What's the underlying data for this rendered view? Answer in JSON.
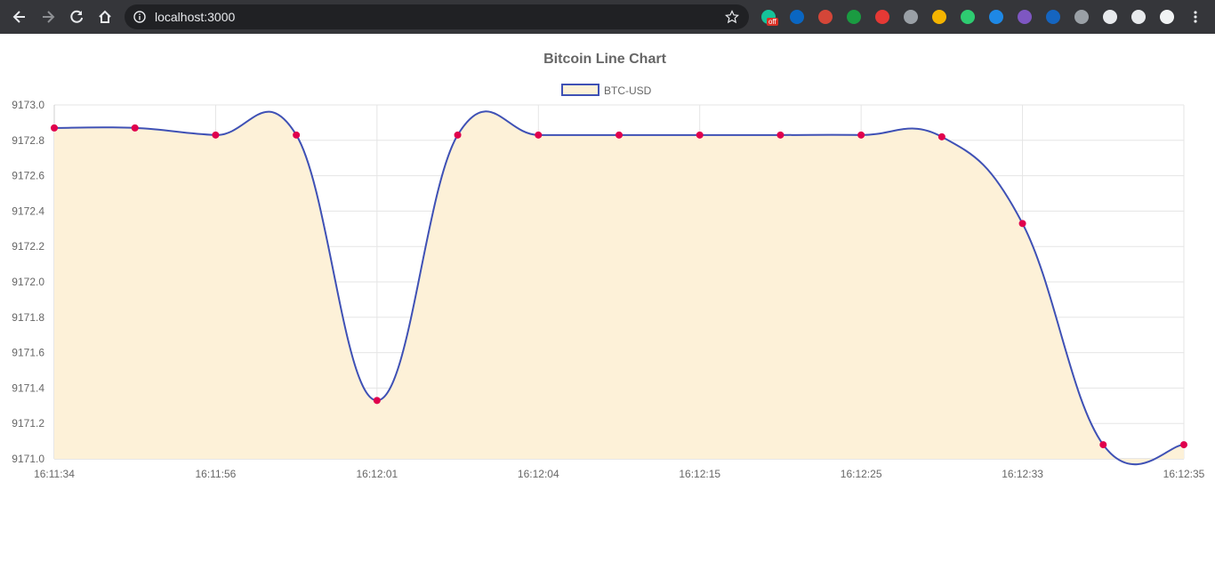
{
  "browser": {
    "url": "localhost:3000",
    "nav": [
      "back-icon",
      "forward-icon",
      "reload-icon",
      "home-icon"
    ],
    "extensions": [
      {
        "name": "grammarly-icon",
        "color": "#15c39a",
        "badge": "off"
      },
      {
        "name": "linkedin-icon",
        "color": "#0a66c2"
      },
      {
        "name": "red-extension-icon",
        "color": "#d44638"
      },
      {
        "name": "utorrent-icon",
        "color": "#1a9b41"
      },
      {
        "name": "blocked-icon",
        "color": "#e53935"
      },
      {
        "name": "target-icon",
        "color": "#9aa0a6"
      },
      {
        "name": "color-extension-icon",
        "color": "#f4b400"
      },
      {
        "name": "green-extension-icon",
        "color": "#2ecc71"
      },
      {
        "name": "cube-icon",
        "color": "#1e88e5"
      },
      {
        "name": "purple-extension-icon",
        "color": "#7e57c2"
      },
      {
        "name": "triangle-icon",
        "color": "#1565c0"
      },
      {
        "name": "grey-circle-icon",
        "color": "#9aa0a6"
      },
      {
        "name": "extensions-puzzle-icon",
        "color": "#e8eaed"
      },
      {
        "name": "media-control-icon",
        "color": "#e8eaed"
      },
      {
        "name": "profile-avatar",
        "color": "#f1f3f4"
      },
      {
        "name": "menu-icon",
        "color": "#e8eaed"
      }
    ]
  },
  "chart_data": {
    "type": "line",
    "title": "Bitcoin Line Chart",
    "categories": [
      "16:11:34",
      "16:11:56",
      "16:12:01",
      "16:12:04",
      "16:12:15",
      "16:12:25",
      "16:12:33",
      "16:12:35"
    ],
    "x_points": 15,
    "series": [
      {
        "name": "BTC-USD",
        "values": [
          9172.87,
          9172.87,
          9172.83,
          9172.83,
          9171.33,
          9172.83,
          9172.83,
          9172.83,
          9172.83,
          9172.83,
          9172.83,
          9172.82,
          9172.33,
          9171.08,
          9171.08
        ],
        "line_color": "#3f51b5",
        "fill_color": "#fdf1d8",
        "point_color": "#e0004d"
      }
    ],
    "ylim": [
      9171.0,
      9173.0
    ],
    "yticks": [
      "9171.0",
      "9171.2",
      "9171.4",
      "9171.6",
      "9171.8",
      "9172.0",
      "9172.2",
      "9172.4",
      "9172.6",
      "9172.8",
      "9173.0"
    ],
    "grid": true,
    "legend": "top-center"
  }
}
